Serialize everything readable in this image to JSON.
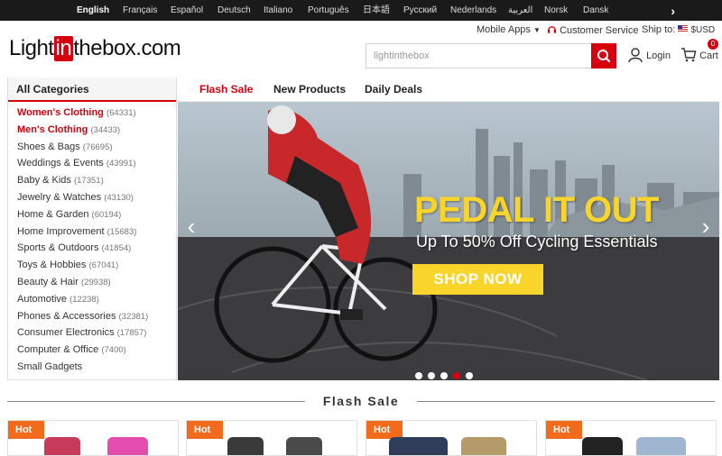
{
  "languages": [
    {
      "label": "English",
      "active": true
    },
    {
      "label": "Français"
    },
    {
      "label": "Español"
    },
    {
      "label": "Deutsch"
    },
    {
      "label": "Italiano"
    },
    {
      "label": "Português"
    },
    {
      "label": "日本語"
    },
    {
      "label": "Русский"
    },
    {
      "label": "Nederlands"
    },
    {
      "label": "العربية"
    },
    {
      "label": "Norsk"
    },
    {
      "label": "Dansk"
    }
  ],
  "header": {
    "logo_pre": "Light",
    "logo_box": "in",
    "logo_post": "thebox.com",
    "mobile_apps": "Mobile Apps",
    "customer_service": "Customer Service",
    "ship_to": "Ship to:",
    "currency": "$USD",
    "search_placeholder": "lightinthebox",
    "login": "Login",
    "cart": "Cart",
    "cart_count": "0"
  },
  "sidebar": {
    "title": "All Categories",
    "items": [
      {
        "label": "Women's Clothing",
        "count": "(64331)",
        "highlight": true
      },
      {
        "label": "Men's Clothing",
        "count": "(34433)",
        "highlight": true
      },
      {
        "label": "Shoes & Bags",
        "count": "(76695)"
      },
      {
        "label": "Weddings & Events",
        "count": "(43991)"
      },
      {
        "label": "Baby & Kids",
        "count": "(17351)"
      },
      {
        "label": "Jewelry & Watches",
        "count": "(43130)"
      },
      {
        "label": "Home & Garden",
        "count": "(60194)"
      },
      {
        "label": "Home Improvement",
        "count": "(15683)"
      },
      {
        "label": "Sports & Outdoors",
        "count": "(41854)"
      },
      {
        "label": "Toys & Hobbies",
        "count": "(67041)"
      },
      {
        "label": "Beauty & Hair",
        "count": "(29938)"
      },
      {
        "label": "Automotive",
        "count": "(12238)"
      },
      {
        "label": "Phones & Accessories",
        "count": "(32381)"
      },
      {
        "label": "Consumer Electronics",
        "count": "(17857)"
      },
      {
        "label": "Computer & Office",
        "count": "(7400)"
      },
      {
        "label": "Small Gadgets",
        "count": ""
      }
    ]
  },
  "tabs": [
    {
      "label": "Flash Sale",
      "active": true
    },
    {
      "label": "New Products"
    },
    {
      "label": "Daily Deals"
    }
  ],
  "banner": {
    "headline": "PEDAL IT OUT",
    "subline": "Up To 50% Off Cycling Essentials",
    "cta": "SHOP NOW",
    "slide_count": 5,
    "active_slide": 4
  },
  "section": {
    "title": "Flash Sale",
    "hot_label": "Hot"
  },
  "colors": {
    "brand_red": "#d7000f",
    "headline_yellow": "#f9d52b",
    "hot_orange": "#f26a1b"
  }
}
